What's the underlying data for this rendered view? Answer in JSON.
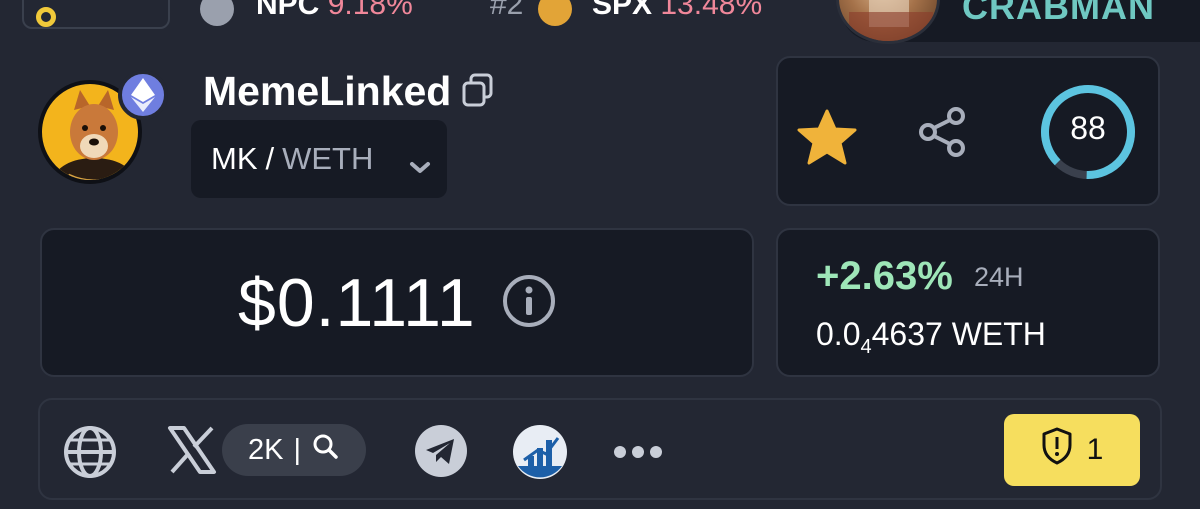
{
  "topbar": {
    "items": [
      {
        "symbol": "NPC",
        "change": "9.18%"
      },
      {
        "rank": "#2",
        "symbol": "SPX",
        "change": "13.48%"
      }
    ],
    "user": {
      "name": "CRABMAN"
    }
  },
  "token": {
    "name": "MemeLinked",
    "chain_icon": "ethereum-icon",
    "pair": {
      "base": "MK",
      "separator": "/",
      "quote": "WETH"
    }
  },
  "actions": {
    "favorite_icon": "star-icon",
    "share_icon": "share-icon",
    "score": "88",
    "score_fraction": 0.88
  },
  "price": {
    "usd": "$0.1111",
    "info_icon": "info-icon"
  },
  "change": {
    "percent": "+2.63%",
    "period": "24H",
    "weth_prefix": "0.0",
    "weth_subscript": "4",
    "weth_digits": "4637",
    "weth_unit": "WETH"
  },
  "links": {
    "icons": [
      "globe-icon",
      "x-icon",
      "search-icon",
      "telegram-icon",
      "chart-icon",
      "more-icon"
    ],
    "x_followers": "2K",
    "audit_count": "1"
  },
  "colors": {
    "background": "#232733",
    "card": "#161a24",
    "positive": "#9ee6b8",
    "negative": "#f0879a",
    "gauge": "#5cc4e0",
    "favorite": "#f0b33a",
    "audit": "#f6de5e"
  }
}
